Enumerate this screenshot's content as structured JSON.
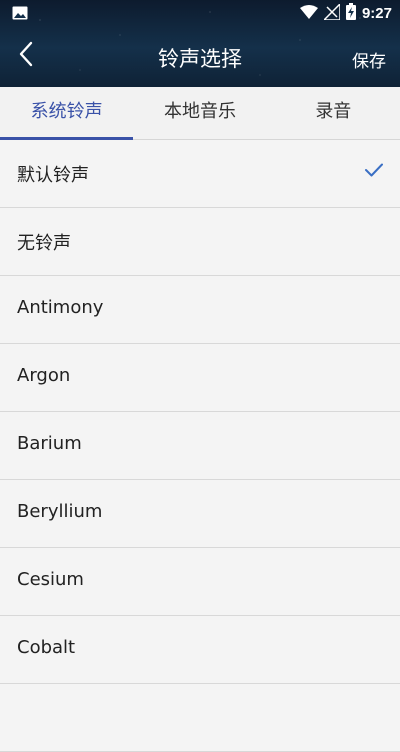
{
  "status_bar": {
    "time": "9:27"
  },
  "header": {
    "title": "铃声选择",
    "save_label": "保存"
  },
  "tabs": [
    {
      "label": "系统铃声",
      "active": true
    },
    {
      "label": "本地音乐",
      "active": false
    },
    {
      "label": "录音",
      "active": false
    }
  ],
  "ringtones": [
    {
      "name": "默认铃声",
      "selected": true
    },
    {
      "name": "无铃声",
      "selected": false
    },
    {
      "name": "Antimony",
      "selected": false
    },
    {
      "name": "Argon",
      "selected": false
    },
    {
      "name": "Barium",
      "selected": false
    },
    {
      "name": "Beryllium",
      "selected": false
    },
    {
      "name": "Cesium",
      "selected": false
    },
    {
      "name": "Cobalt",
      "selected": false
    }
  ],
  "colors": {
    "accent": "#3a52a8",
    "check": "#3a6fc4",
    "header_bg": "#0f2236"
  }
}
